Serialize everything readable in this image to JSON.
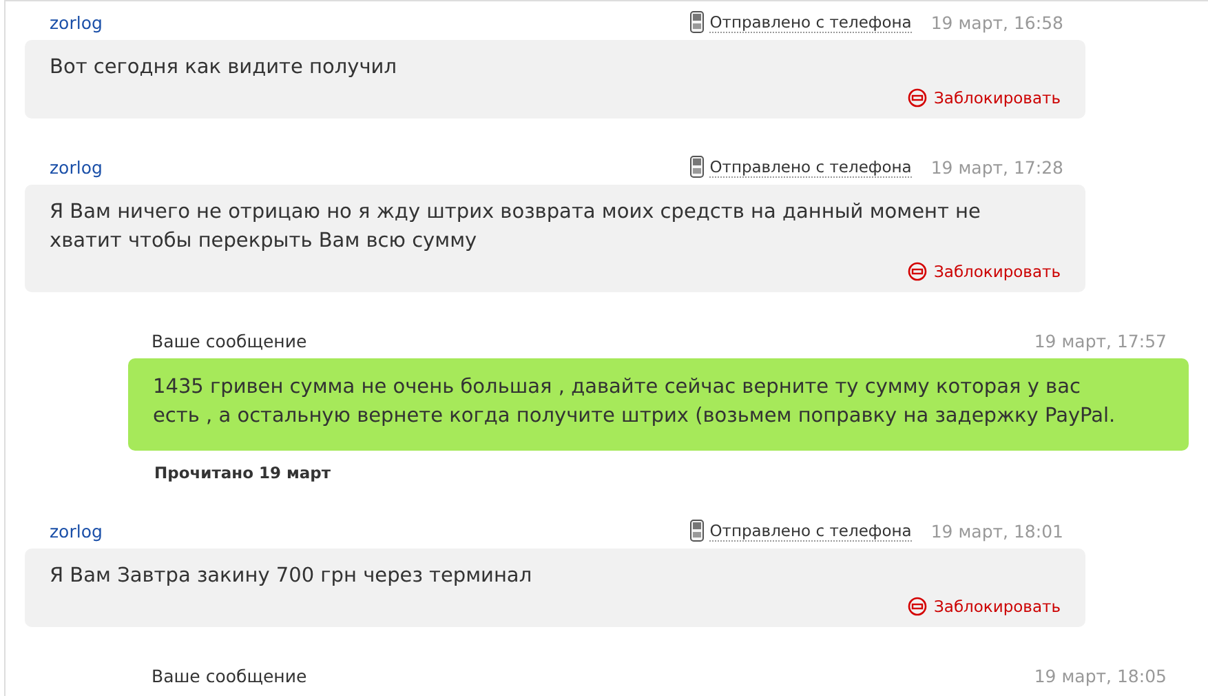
{
  "messages": [
    {
      "kind": "incoming",
      "author": "zorlog",
      "via": "Отправлено с телефона",
      "time": "19 март, 16:58",
      "text": "Вот сегодня как видите получил",
      "action": "Заблокировать"
    },
    {
      "kind": "incoming",
      "author": "zorlog",
      "via": "Отправлено с телефона",
      "time": "19 март, 17:28",
      "text": "Я Вам ничего не отрицаю но я жду штрих возврата моих средств на данный момент не хватит чтобы перекрыть Вам всю сумму",
      "action": "Заблокировать"
    },
    {
      "kind": "outgoing",
      "author": "Ваше сообщение",
      "time": "19 март, 17:57",
      "text": "1435 гривен сумма не очень большая , давайте сейчас верните ту сумму которая у вас есть , а остальную вернете когда получите штрих (возьмем поправку на задержку PayPal.",
      "status": "Прочитано 19 март"
    },
    {
      "kind": "incoming",
      "author": "zorlog",
      "via": "Отправлено с телефона",
      "time": "19 март, 18:01",
      "text": "Я Вам Завтра закину 700 грн через терминал",
      "action": "Заблокировать"
    },
    {
      "kind": "outgoing",
      "author": "Ваше сообщение",
      "time": "19 март, 18:05"
    }
  ]
}
